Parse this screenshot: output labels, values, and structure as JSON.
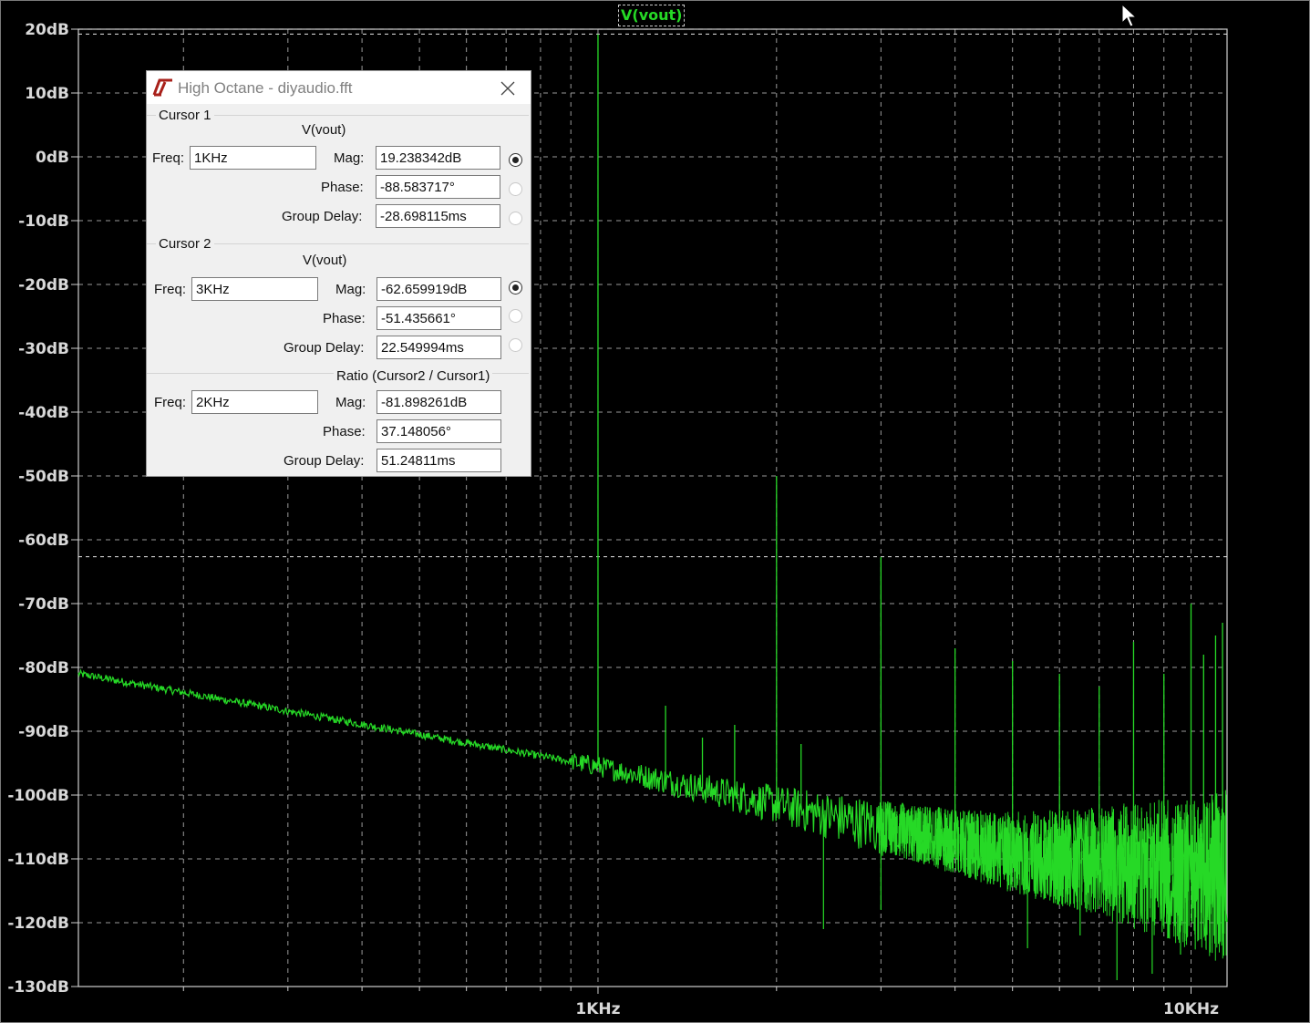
{
  "window": {
    "title": "High Octane - diyaudio.fft",
    "trace_label": "V(vout)"
  },
  "cursor1": {
    "legend": "Cursor 1",
    "trace": "V(vout)",
    "freq_label": "Freq:",
    "freq": "1KHz",
    "mag_label": "Mag:",
    "mag": "19.238342dB",
    "phase_label": "Phase:",
    "phase": "-88.583717°",
    "gd_label": "Group Delay:",
    "group_delay": "-28.698115ms",
    "selected": "mag"
  },
  "cursor2": {
    "legend": "Cursor 2",
    "trace": "V(vout)",
    "freq_label": "Freq:",
    "freq": "3KHz",
    "mag_label": "Mag:",
    "mag": "-62.659919dB",
    "phase_label": "Phase:",
    "phase": "-51.435661°",
    "gd_label": "Group Delay:",
    "group_delay": "22.549994ms",
    "selected": "mag"
  },
  "ratio": {
    "legend": "Ratio (Cursor2 / Cursor1)",
    "freq_label": "Freq:",
    "freq": "2KHz",
    "mag_label": "Mag:",
    "mag": "-81.898261dB",
    "phase_label": "Phase:",
    "phase": "37.148056°",
    "gd_label": "Group Delay:",
    "group_delay": "51.24811ms"
  },
  "chart_data": {
    "type": "line",
    "x_scale": "log",
    "xlim_hz": [
      133,
      11500
    ],
    "ylim_db": [
      -130,
      20
    ],
    "y_ticks": [
      "20dB",
      "10dB",
      "0dB",
      "-10dB",
      "-20dB",
      "-30dB",
      "-40dB",
      "-50dB",
      "-60dB",
      "-70dB",
      "-80dB",
      "-90dB",
      "-100dB",
      "-110dB",
      "-120dB",
      "-130dB"
    ],
    "x_tick_labels": [
      {
        "hz": 1000,
        "label": "1KHz"
      },
      {
        "hz": 10000,
        "label": "10KHz"
      }
    ],
    "grid": true,
    "cursors_db": [
      19.238342,
      -62.659919
    ],
    "series": [
      {
        "name": "V(vout)",
        "color": "#26d926",
        "noise_floor": [
          [
            133,
            -81
          ],
          [
            1000,
            -95.5
          ],
          [
            3000,
            -105
          ],
          [
            5000,
            -109
          ],
          [
            10000,
            -112
          ],
          [
            11500,
            -113
          ]
        ],
        "spikes": [
          {
            "hz": 1000,
            "db": 19.2
          },
          {
            "hz": 2000,
            "db": -50
          },
          {
            "hz": 3000,
            "db": -62.7
          },
          {
            "hz": 1300,
            "db": -86
          },
          {
            "hz": 1500,
            "db": -91
          },
          {
            "hz": 1700,
            "db": -89
          },
          {
            "hz": 2200,
            "db": -92
          },
          {
            "hz": 4000,
            "db": -77
          },
          {
            "hz": 5000,
            "db": -79
          },
          {
            "hz": 6000,
            "db": -81
          },
          {
            "hz": 7000,
            "db": -83
          },
          {
            "hz": 8000,
            "db": -76
          },
          {
            "hz": 9000,
            "db": -81
          },
          {
            "hz": 10000,
            "db": -70
          },
          {
            "hz": 11000,
            "db": -75
          },
          {
            "hz": 10500,
            "db": -78
          },
          {
            "hz": 11300,
            "db": -73
          }
        ],
        "dips": [
          {
            "hz": 2400,
            "db": -121
          },
          {
            "hz": 3000,
            "db": -118
          },
          {
            "hz": 5300,
            "db": -124
          },
          {
            "hz": 6500,
            "db": -122
          },
          {
            "hz": 7500,
            "db": -129
          },
          {
            "hz": 8600,
            "db": -128
          },
          {
            "hz": 9600,
            "db": -125
          }
        ]
      }
    ]
  }
}
